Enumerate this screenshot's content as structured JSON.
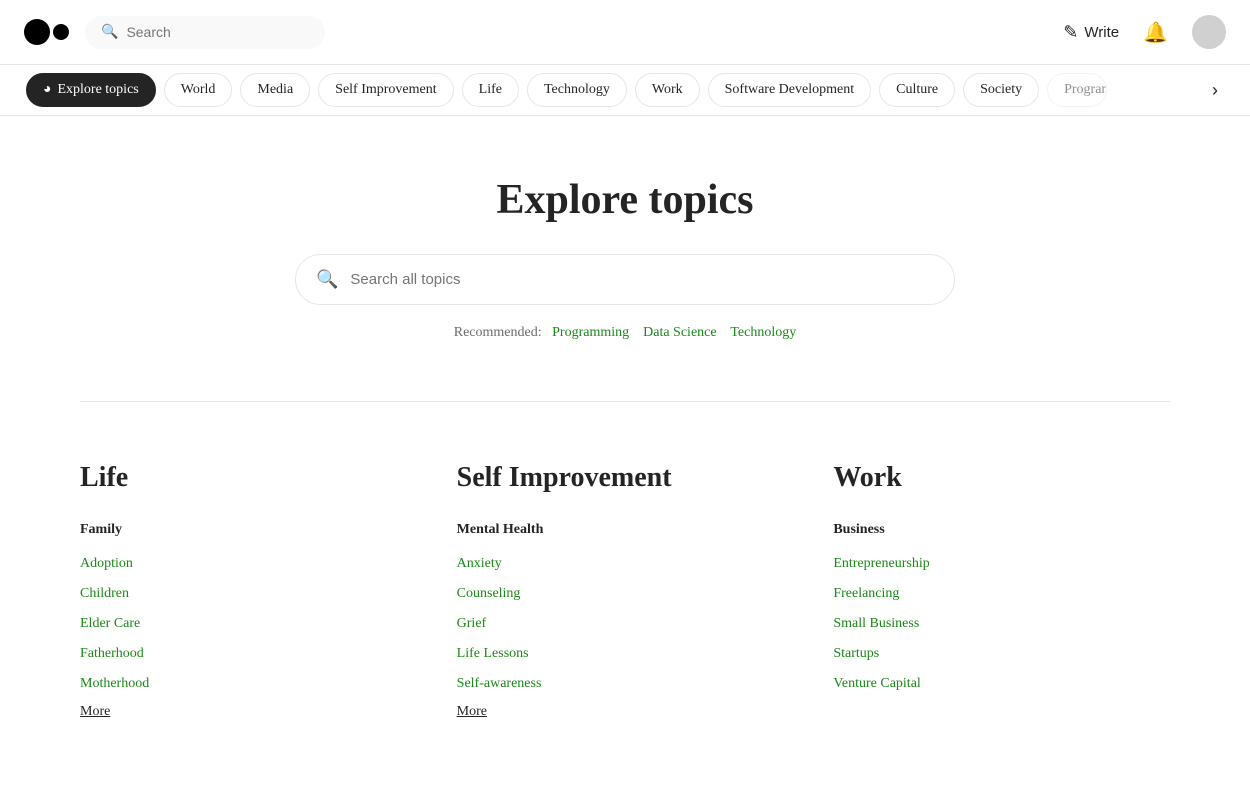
{
  "header": {
    "search_placeholder": "Search",
    "write_label": "Write"
  },
  "topic_nav": {
    "active_item": "Explore topics",
    "items": [
      "World",
      "Media",
      "Self Improvement",
      "Life",
      "Technology",
      "Work",
      "Software Development",
      "Culture",
      "Society",
      "Programming"
    ]
  },
  "hero": {
    "title": "Explore topics",
    "search_placeholder": "Search all topics",
    "recommended_label": "Recommended:",
    "recommended_links": [
      "Programming",
      "Data Science",
      "Technology"
    ]
  },
  "categories": [
    {
      "title": "Life",
      "subcategories": [
        {
          "title": "Family",
          "links": [
            "Adoption",
            "Children",
            "Elder Care",
            "Fatherhood",
            "Motherhood"
          ],
          "more": "More"
        }
      ]
    },
    {
      "title": "Self Improvement",
      "subcategories": [
        {
          "title": "Mental Health",
          "links": [
            "Anxiety",
            "Counseling",
            "Grief",
            "Life Lessons",
            "Self-awareness"
          ],
          "more": "More"
        }
      ]
    },
    {
      "title": "Work",
      "subcategories": [
        {
          "title": "Business",
          "links": [
            "Entrepreneurship",
            "Freelancing",
            "Small Business",
            "Startups",
            "Venture Capital"
          ],
          "more": null
        }
      ]
    }
  ]
}
